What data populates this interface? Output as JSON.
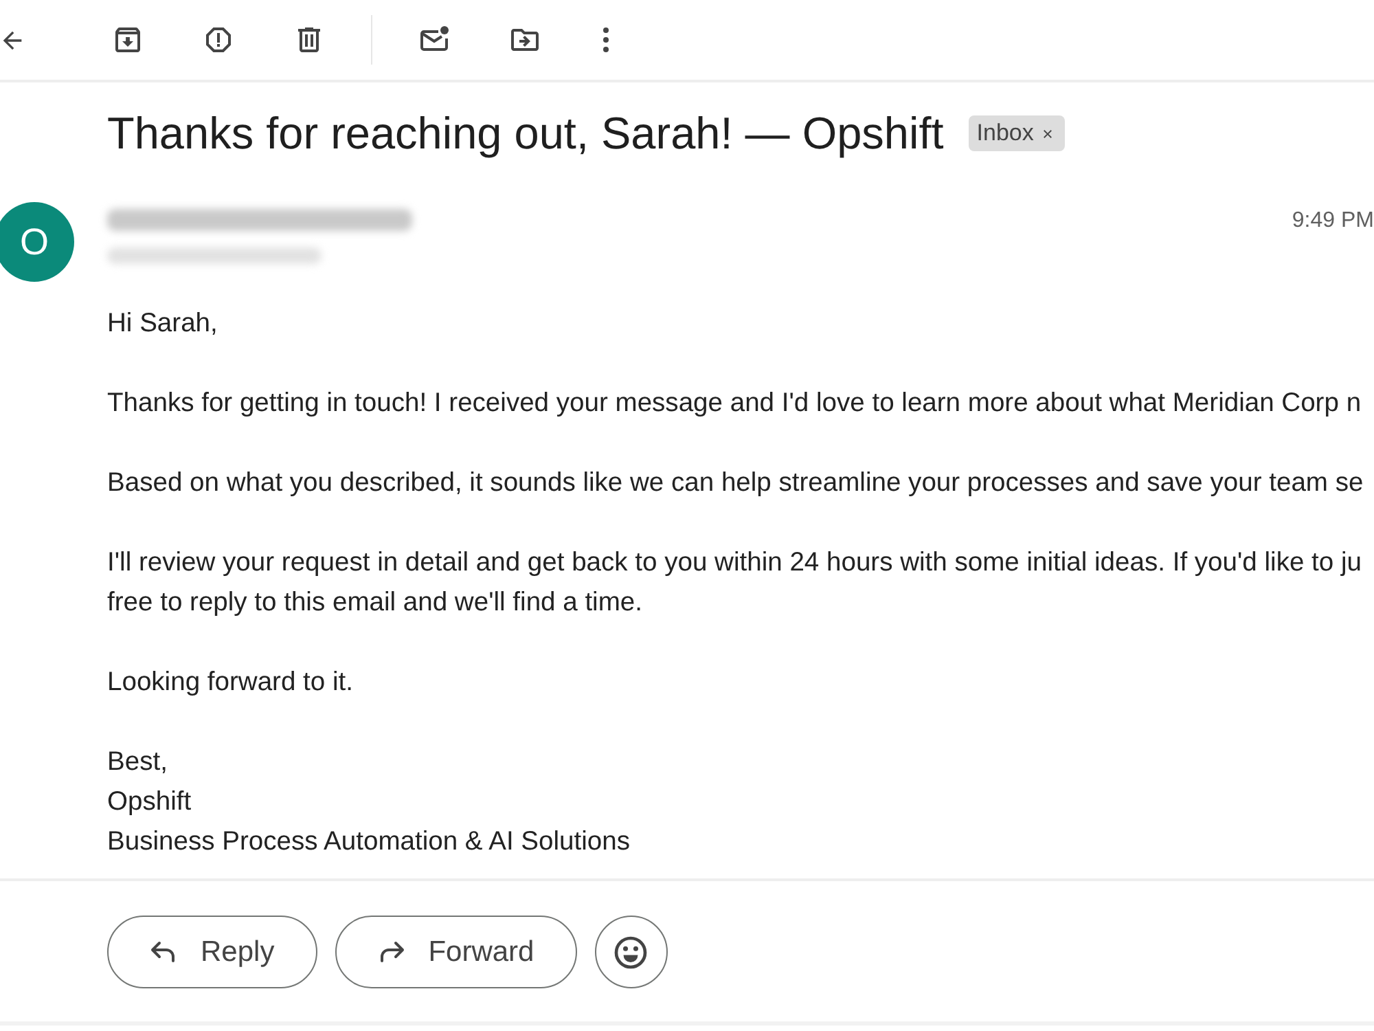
{
  "subject": {
    "title": "Thanks for reaching out, Sarah! — Opshift",
    "labels": [
      {
        "text": "Inbox"
      }
    ]
  },
  "message": {
    "avatar_letter": "O",
    "time": "9:49 PM"
  },
  "body": {
    "paragraphs": [
      {
        "lines": [
          "Hi Sarah,"
        ]
      },
      {
        "lines": [
          "Thanks for getting in touch! I received your message and I'd love to learn more about what Meridian Corp n"
        ]
      },
      {
        "lines": [
          "Based on what you described, it sounds like we can help streamline your processes and save your team se"
        ]
      },
      {
        "lines": [
          "I'll review your request in detail and get back to you within 24 hours with some initial ideas. If you'd like to ju",
          "free to reply to this email and we'll find a time."
        ]
      },
      {
        "lines": [
          "Looking forward to it."
        ]
      },
      {
        "lines": [
          "Best,",
          "Opshift",
          "Business Process Automation & AI Solutions"
        ]
      }
    ]
  },
  "actions": [
    {
      "kind": "reply",
      "label": "Reply"
    },
    {
      "kind": "forward",
      "label": "Forward"
    }
  ]
}
